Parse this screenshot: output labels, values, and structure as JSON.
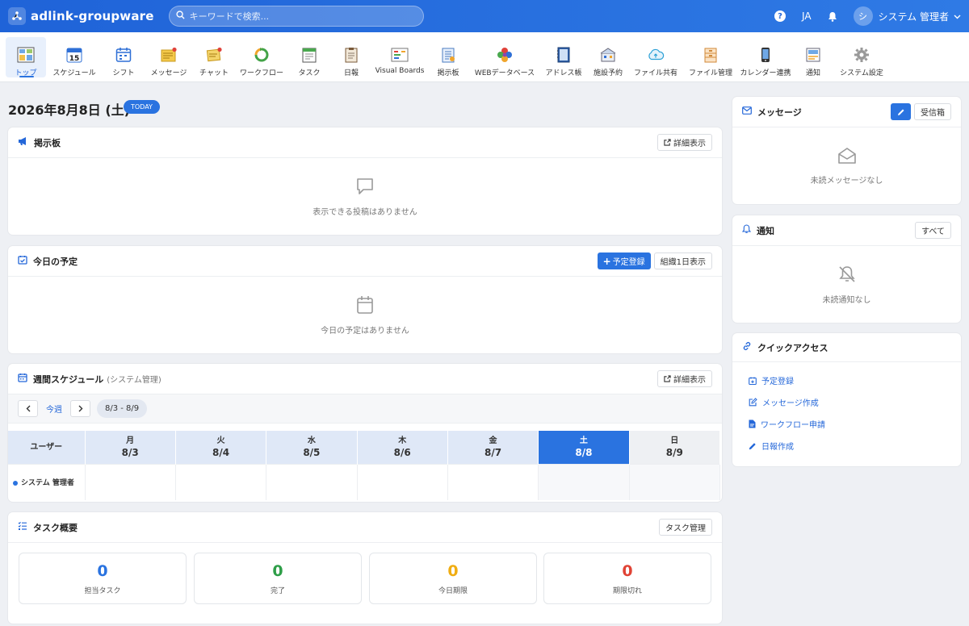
{
  "header": {
    "brand": "adlink-groupware",
    "search_placeholder": "キーワードで検索...",
    "lang": "JA",
    "user_initial": "シ",
    "user_name": "システム 管理者"
  },
  "apps": [
    {
      "label": "トップ",
      "icon": "top-icon",
      "active": true
    },
    {
      "label": "スケジュール",
      "icon": "calendar-15-icon"
    },
    {
      "label": "シフト",
      "icon": "shift-calendar-icon"
    },
    {
      "label": "メッセージ",
      "icon": "message-icon"
    },
    {
      "label": "チャット",
      "icon": "chat-icon"
    },
    {
      "label": "ワークフロー",
      "icon": "workflow-icon"
    },
    {
      "label": "タスク",
      "icon": "task-icon"
    },
    {
      "label": "日報",
      "icon": "daily-report-icon"
    },
    {
      "label": "Visual Boards",
      "icon": "visual-boards-icon"
    },
    {
      "label": "掲示板",
      "icon": "bulletin-board-icon"
    },
    {
      "label": "WEBデータベース",
      "icon": "web-database-icon"
    },
    {
      "label": "アドレス帳",
      "icon": "address-book-icon"
    },
    {
      "label": "施設予約",
      "icon": "facility-reservation-icon"
    },
    {
      "label": "ファイル共有",
      "icon": "file-share-icon"
    },
    {
      "label": "ファイル管理",
      "icon": "file-management-icon"
    },
    {
      "label": "カレンダー連携",
      "icon": "calendar-sync-icon"
    },
    {
      "label": "通知",
      "icon": "notification-app-icon"
    },
    {
      "label": "システム設定",
      "icon": "system-settings-icon"
    }
  ],
  "main": {
    "date": "2026年8月8日 (土)",
    "today_badge": "TODAY",
    "bulletin": {
      "title": "掲示板",
      "detail_button": "詳細表示",
      "empty": "表示できる投稿はありません"
    },
    "today_schedule": {
      "title": "今日の予定",
      "add_button": "予定登録",
      "org_button": "組織1日表示",
      "empty": "今日の予定はありません"
    },
    "weekly": {
      "title": "週間スケジュール",
      "subtitle": "(システム管理)",
      "detail_button": "詳細表示",
      "this_week": "今週",
      "range": "8/3 - 8/9",
      "user_header": "ユーザー",
      "days": [
        {
          "dow": "月",
          "date": "8/3"
        },
        {
          "dow": "火",
          "date": "8/4"
        },
        {
          "dow": "水",
          "date": "8/5"
        },
        {
          "dow": "木",
          "date": "8/6"
        },
        {
          "dow": "金",
          "date": "8/7"
        },
        {
          "dow": "土",
          "date": "8/8"
        },
        {
          "dow": "日",
          "date": "8/9"
        }
      ],
      "user": "システム 管理者"
    },
    "tasks": {
      "title": "タスク概要",
      "manage_button": "タスク管理",
      "stats": [
        {
          "value": "0",
          "label": "担当タスク",
          "color": "#2a73e0"
        },
        {
          "value": "0",
          "label": "完了",
          "color": "#2e9e48"
        },
        {
          "value": "0",
          "label": "今日期限",
          "color": "#f0ad12"
        },
        {
          "value": "0",
          "label": "期限切れ",
          "color": "#e04335"
        }
      ]
    }
  },
  "side": {
    "messages": {
      "title": "メッセージ",
      "inbox_button": "受信箱",
      "empty": "未読メッセージなし"
    },
    "notifications": {
      "title": "通知",
      "all_button": "すべて",
      "empty": "未読通知なし"
    },
    "quick_access": {
      "title": "クイックアクセス",
      "items": [
        {
          "label": "予定登録",
          "icon": "calendar-plus-icon"
        },
        {
          "label": "メッセージ作成",
          "icon": "compose-icon"
        },
        {
          "label": "ワークフロー申請",
          "icon": "document-icon"
        },
        {
          "label": "日報作成",
          "icon": "pencil-icon"
        }
      ]
    }
  },
  "colors": {
    "primary": "#2a73e0",
    "header_start": "#1f63d8",
    "header_end": "#2f7ae5"
  }
}
